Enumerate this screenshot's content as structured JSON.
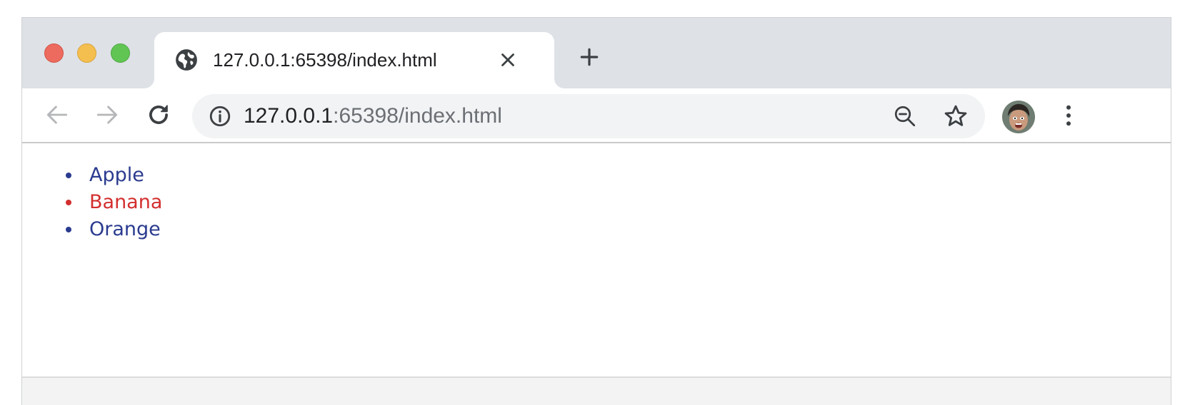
{
  "tab": {
    "title": "127.0.0.1:65398/index.html",
    "favicon": "globe-icon",
    "close": "close-icon"
  },
  "toolbar": {
    "back": "arrow-left-icon",
    "forward": "arrow-right-icon",
    "reload": "reload-icon",
    "url_host": "127.0.0.1",
    "url_rest": ":65398/index.html",
    "info": "info-icon",
    "zoom": "zoom-out-icon",
    "bookmark": "star-icon",
    "profile": "avatar",
    "menu": "more-vertical-icon"
  },
  "traffic_lights": {
    "close_color": "#ed6a5e",
    "minimize_color": "#f4bf4f",
    "maximize_color": "#61c554"
  },
  "page": {
    "items": [
      {
        "label": "Apple",
        "color": "#2a3b8f"
      },
      {
        "label": "Banana",
        "color": "#d32f2f"
      },
      {
        "label": "Orange",
        "color": "#2a3b8f"
      }
    ]
  }
}
